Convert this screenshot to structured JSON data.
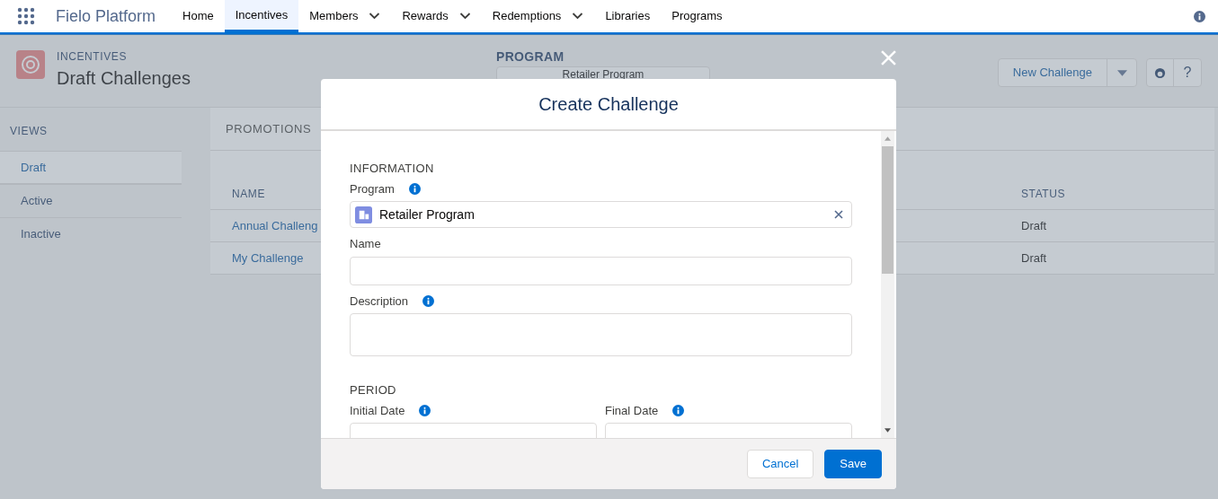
{
  "app": {
    "name": "Fielo Platform",
    "nav": [
      {
        "label": "Home",
        "selected": false,
        "has_menu": false
      },
      {
        "label": "Incentives",
        "selected": true,
        "has_menu": false
      },
      {
        "label": "Members",
        "selected": false,
        "has_menu": true
      },
      {
        "label": "Rewards",
        "selected": false,
        "has_menu": true
      },
      {
        "label": "Redemptions",
        "selected": false,
        "has_menu": true
      },
      {
        "label": "Libraries",
        "selected": false,
        "has_menu": false
      },
      {
        "label": "Programs",
        "selected": false,
        "has_menu": false
      }
    ]
  },
  "page": {
    "eyebrow": "INCENTIVES",
    "title": "Draft Challenges",
    "program_label": "PROGRAM",
    "program_value": "Retailer Program",
    "new_button": "New Challenge",
    "help_label": "?",
    "views_heading": "VIEWS",
    "views": [
      {
        "label": "Draft",
        "selected": true
      },
      {
        "label": "Active",
        "selected": false
      },
      {
        "label": "Inactive",
        "selected": false
      }
    ],
    "tab": "PROMOTIONS",
    "columns": [
      "NAME",
      "STATUS"
    ],
    "rows": [
      {
        "name": "Annual Challeng",
        "status": "Draft"
      },
      {
        "name": "My Challenge",
        "status": "Draft"
      }
    ]
  },
  "modal": {
    "title": "Create Challenge",
    "sections": [
      {
        "heading": "INFORMATION",
        "fields": [
          {
            "kind": "lookup",
            "label": "Program",
            "info": true,
            "value": "Retailer Program"
          },
          {
            "kind": "text",
            "label": "Name",
            "info": false
          },
          {
            "kind": "textarea",
            "label": "Description",
            "info": true
          }
        ]
      },
      {
        "heading": "PERIOD",
        "fields": [
          {
            "kind": "date",
            "label": "Initial Date",
            "info": true
          },
          {
            "kind": "date",
            "label": "Final Date",
            "info": true
          }
        ]
      }
    ],
    "buttons": [
      {
        "label": "Cancel",
        "kind": "neutral"
      },
      {
        "label": "Save",
        "kind": "brand"
      }
    ]
  }
}
